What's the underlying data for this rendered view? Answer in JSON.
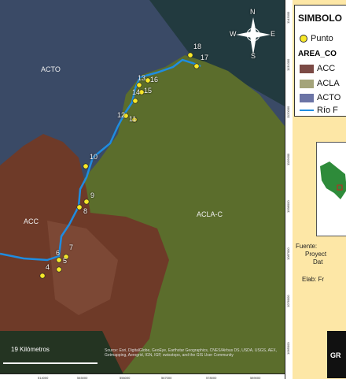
{
  "map": {
    "areas": [
      {
        "name": "ACTO"
      },
      {
        "name": "ACC"
      },
      {
        "name": "ACLA-C"
      }
    ],
    "points": [
      {
        "id": "4"
      },
      {
        "id": "5"
      },
      {
        "id": "6"
      },
      {
        "id": "7"
      },
      {
        "id": "8"
      },
      {
        "id": "9"
      },
      {
        "id": "10"
      },
      {
        "id": "11"
      },
      {
        "id": "12"
      },
      {
        "id": "13"
      },
      {
        "id": "14"
      },
      {
        "id": "15"
      },
      {
        "id": "16"
      },
      {
        "id": "17"
      },
      {
        "id": "18"
      }
    ],
    "scale_label": "19 Kilómetros",
    "attribution": "Source: Esri, DigitalGlobe, GeoEye, Earthstar Geographics, CNES/Airbus DS, USDA, USGS, AEX, Getmapping, Aerogrid, IGN, IGP, swisstopo, and the GIS User Community",
    "x_ticks": [
      "514000",
      "545000",
      "556000",
      "567000",
      "578000",
      "589000"
    ],
    "y_ticks": [
      "1143000",
      "1131000",
      "1120000",
      "1109000",
      "1098000",
      "1087000",
      "1076000",
      "1065000"
    ],
    "compass": {
      "n": "N",
      "s": "S",
      "e": "E",
      "w": "W"
    }
  },
  "legend": {
    "title": "SIMBOLO",
    "point_label": "Punto",
    "area_header": "AREA_CO",
    "area_items": [
      {
        "label": "ACC",
        "color": "#7b4a45"
      },
      {
        "label": "ACLA",
        "color": "#a4a47a"
      },
      {
        "label": "ACTO",
        "color": "#6b74a5"
      }
    ],
    "river_label": "Río F"
  },
  "panel": {
    "source_lines": [
      "Fuente: ",
      "Proyect",
      "Dat"
    ],
    "elaborated": "Elab: Fr",
    "logo_text": "GR"
  },
  "colors": {
    "point": "#f7e829",
    "river": "#1f8ce0",
    "acto": "#3c4d70",
    "acc": "#6f3a2a",
    "acla": "#596b2c"
  }
}
